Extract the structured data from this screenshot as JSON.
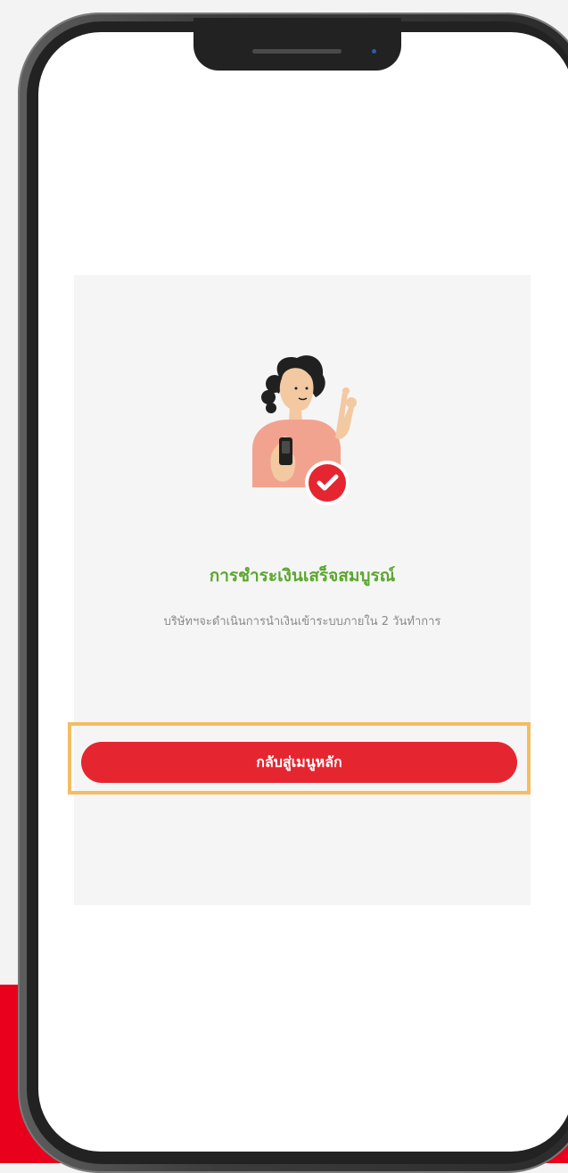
{
  "screen": {
    "title": "การชำระเงินเสร็จสมบูรณ์",
    "subtitle": "บริษัทฯจะดำเนินการนำเงินเข้าระบบภายใน 2 วันทำการ",
    "button_label": "กลับสู่เมนูหลัก"
  },
  "colors": {
    "accent_red": "#e52631",
    "success_green": "#5ca72f",
    "highlight_orange": "#f4bd62",
    "card_bg": "#f5f5f5"
  },
  "icons": {
    "illustration": "woman-with-phone-illustration",
    "success": "check-circle-icon"
  }
}
